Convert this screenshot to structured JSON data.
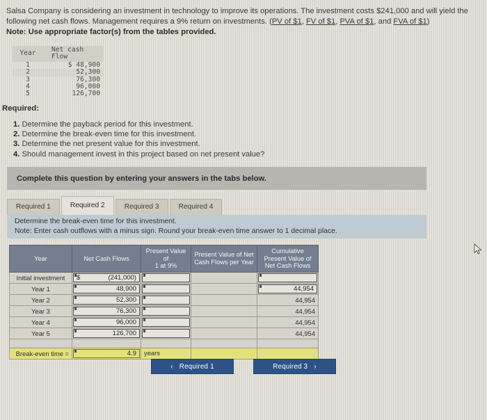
{
  "problem": {
    "line1": "Salsa Company is considering an investment in technology to improve its operations. The investment costs $241,000 and will yield the",
    "line2_pre": "following net cash flows. Management requires a 9% return on investments. (",
    "links": [
      "PV of $1",
      "FV of $1",
      "PVA of $1",
      "FVA of $1"
    ],
    "link_sep1": ", ",
    "link_sep2": ", ",
    "link_sep3": ", and ",
    "line2_post": ")",
    "note": "Note: Use appropriate factor(s) from the tables provided."
  },
  "given_table": {
    "headers": [
      "Year",
      "Net cash Flow"
    ],
    "rows": [
      {
        "year": "1",
        "value": "$ 48,900"
      },
      {
        "year": "2",
        "value": "52,300"
      },
      {
        "year": "3",
        "value": "76,300"
      },
      {
        "year": "4",
        "value": "96,000"
      },
      {
        "year": "5",
        "value": "126,700"
      }
    ]
  },
  "required": {
    "heading": "Required:",
    "items": [
      {
        "num": "1.",
        "text": "Determine the payback period for this investment."
      },
      {
        "num": "2.",
        "text": "Determine the break-even time for this investment."
      },
      {
        "num": "3.",
        "text": "Determine the net present value for this investment."
      },
      {
        "num": "4.",
        "text": "Should management invest in this project based on net present value?"
      }
    ]
  },
  "banner": {
    "text": "Complete this question by entering your answers in the tabs below."
  },
  "tabs": [
    {
      "label": "Required 1",
      "active": false
    },
    {
      "label": "Required 2",
      "active": true
    },
    {
      "label": "Required 3",
      "active": false
    },
    {
      "label": "Required 4",
      "active": false
    }
  ],
  "instruction": {
    "line1": "Determine the break-even time for this investment.",
    "line2": "Note: Enter cash outflows with a minus sign. Round your break-even time answer to 1 decimal place."
  },
  "answer_table": {
    "headers": [
      "Year",
      "Net Cash Flows",
      "Present Value of 1 at 9%",
      "Present Value of Net Cash Flows per Year",
      "Cumulative Present Value of Net Cash Flows"
    ],
    "header_lines": [
      [
        "Year"
      ],
      [
        "Net Cash Flows"
      ],
      [
        "Present Value of",
        "1 at 9%"
      ],
      [
        "Present Value of Net",
        "Cash Flows per Year"
      ],
      [
        "Cumulative",
        "Present Value of",
        "Net Cash Flows"
      ]
    ],
    "rows": [
      {
        "label": "Initial investment",
        "dollar": "$",
        "net_cash_flow": "(241,000)",
        "pv_factor": "",
        "pv_per_year": "",
        "cumulative": ""
      },
      {
        "label": "Year 1",
        "dollar": "",
        "net_cash_flow": "48,900",
        "pv_factor": "",
        "pv_per_year": "",
        "cumulative": "44,954"
      },
      {
        "label": "Year 2",
        "dollar": "",
        "net_cash_flow": "52,300",
        "pv_factor": "",
        "pv_per_year": "",
        "cumulative": "44,954"
      },
      {
        "label": "Year 3",
        "dollar": "",
        "net_cash_flow": "76,300",
        "pv_factor": "",
        "pv_per_year": "",
        "cumulative": "44,954"
      },
      {
        "label": "Year 4",
        "dollar": "",
        "net_cash_flow": "96,000",
        "pv_factor": "",
        "pv_per_year": "",
        "cumulative": "44,954"
      },
      {
        "label": "Year 5",
        "dollar": "",
        "net_cash_flow": "126,700",
        "pv_factor": "",
        "pv_per_year": "",
        "cumulative": "44,954"
      }
    ],
    "breakeven": {
      "label": "Break-even time =",
      "value": "4.9",
      "unit": "years"
    }
  },
  "nav": {
    "prev_label": "Required 1",
    "prev_chevron": "‹",
    "next_label": "Required 3",
    "next_chevron": "›"
  },
  "colors": {
    "page_bg": "#dedbd2",
    "banner_bg": "#b7b5b0",
    "instruction_bg": "#bfcbd2",
    "table_header_bg": "#737f90",
    "highlight_yellow": "#e3e27a",
    "button_blue": "#2e5288"
  }
}
